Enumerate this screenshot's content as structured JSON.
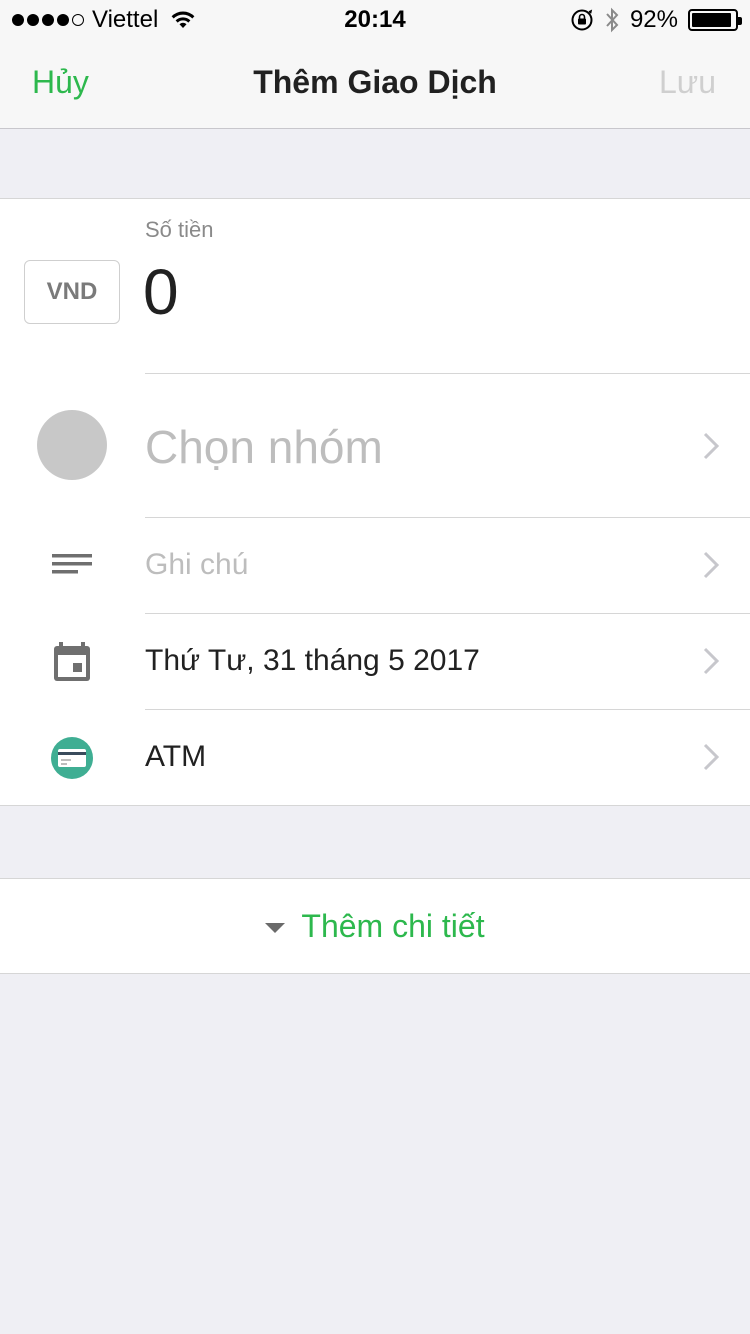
{
  "status_bar": {
    "carrier": "Viettel",
    "time": "20:14",
    "battery_percent": "92%",
    "battery_level": 0.92,
    "signal_bars_filled": 4,
    "signal_bars_total": 5
  },
  "nav": {
    "cancel_label": "Hủy",
    "title": "Thêm Giao Dịch",
    "save_label": "Lưu"
  },
  "amount": {
    "label": "Số tiền",
    "currency": "VND",
    "value": "0"
  },
  "fields": {
    "group_placeholder": "Chọn nhóm",
    "note_placeholder": "Ghi chú",
    "date": "Thứ Tư, 31 tháng 5 2017",
    "wallet": "ATM"
  },
  "details": {
    "label": "Thêm chi tiết"
  },
  "colors": {
    "accent": "#2db84d",
    "wallet_icon": "#3fae93"
  }
}
